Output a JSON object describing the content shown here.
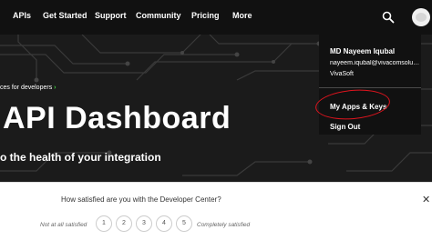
{
  "nav": {
    "items": [
      {
        "label": "APIs"
      },
      {
        "label": "Get Started"
      },
      {
        "label": "Support"
      },
      {
        "label": "Community"
      },
      {
        "label": "Pricing"
      },
      {
        "label": "More"
      }
    ],
    "search_icon": "search-icon",
    "avatar_icon": "user-avatar-icon"
  },
  "hero": {
    "breadcrumb": "ces for developers",
    "breadcrumb_chevron": "›",
    "title": "API Dashboard",
    "subtitle": "o the health of your integration"
  },
  "account_menu": {
    "name": "MD Nayeem Iqubal",
    "email": "nayeem.iqubal@vivacomsoluti...",
    "company": "VivaSoft",
    "links": [
      {
        "label": "My Apps & Keys"
      },
      {
        "label": "Sign Out"
      }
    ],
    "highlight_color": "#e0141e"
  },
  "survey": {
    "question": "How satisfied are you with the Developer Center?",
    "low_label": "Not at all satisfied",
    "high_label": "Completely satisfied",
    "options": [
      "1",
      "2",
      "3",
      "4",
      "5"
    ],
    "close_glyph": "✕"
  },
  "colors": {
    "navbar": "#111111",
    "accent_green": "#3fcf3f"
  }
}
